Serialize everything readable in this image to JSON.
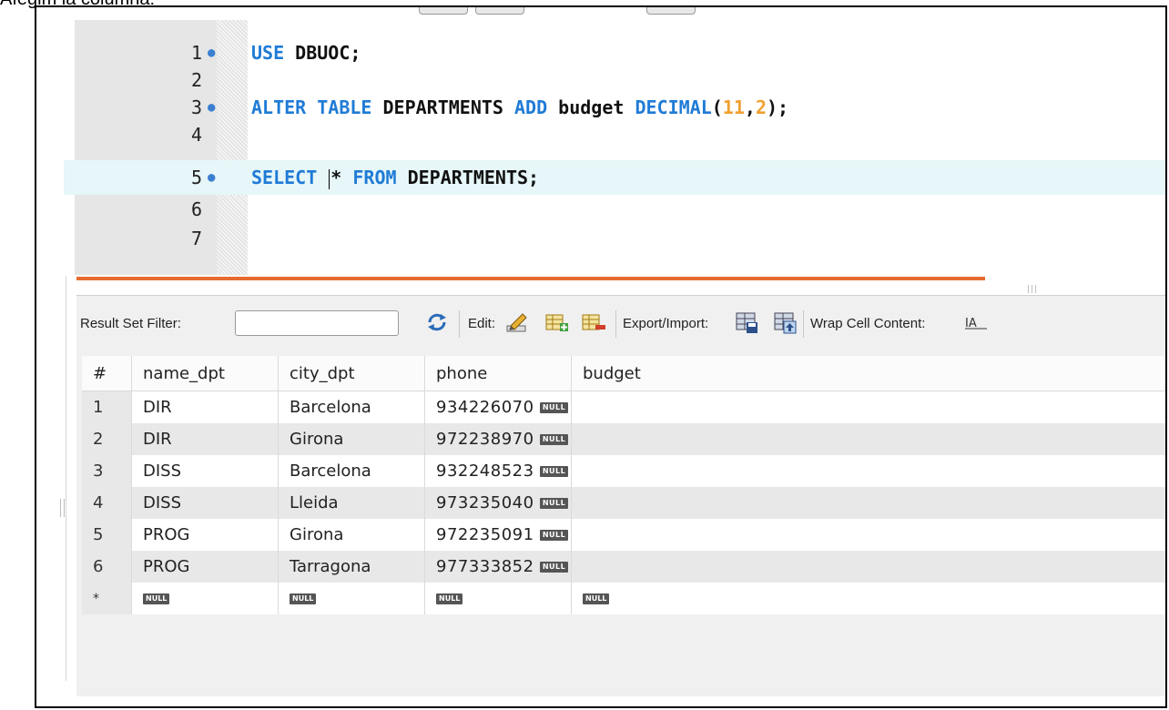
{
  "caption": "Afegim la columna:",
  "editor": {
    "lines": [
      {
        "n": "1",
        "marker": true
      },
      {
        "n": "2",
        "marker": false
      },
      {
        "n": "3",
        "marker": true
      },
      {
        "n": "4",
        "marker": false
      },
      {
        "n": "5",
        "marker": true
      },
      {
        "n": "6",
        "marker": false
      },
      {
        "n": "7",
        "marker": false
      }
    ],
    "code": {
      "l1_kw": "USE",
      "l1_rest": " DBUOC;",
      "l3_kw1": "ALTER TABLE",
      "l3_mid1": " DEPARTMENTS ",
      "l3_kw2": "ADD",
      "l3_mid2": " budget ",
      "l3_kw3": "DECIMAL",
      "l3_p1": "(",
      "l3_n1": "11",
      "l3_comma": ",",
      "l3_n2": "2",
      "l3_end": ");",
      "l5_kw1": "SELECT",
      "l5_star": "* ",
      "l5_kw2": "FROM",
      "l5_rest": " DEPARTMENTS;"
    }
  },
  "toolbar": {
    "filter_label": "Result Set Filter:",
    "edit_label": "Edit:",
    "export_label": "Export/Import:",
    "wrap_label": "Wrap Cell Content:"
  },
  "grid": {
    "columns": [
      "#",
      "name_dpt",
      "city_dpt",
      "phone",
      "budget"
    ],
    "null_label": "NULL",
    "new_row_marker": "*",
    "rows": [
      {
        "num": "1",
        "name_dpt": "DIR",
        "city_dpt": "Barcelona",
        "phone": "934226070"
      },
      {
        "num": "2",
        "name_dpt": "DIR",
        "city_dpt": "Girona",
        "phone": "972238970"
      },
      {
        "num": "3",
        "name_dpt": "DISS",
        "city_dpt": "Barcelona",
        "phone": "932248523"
      },
      {
        "num": "4",
        "name_dpt": "DISS",
        "city_dpt": "Lleida",
        "phone": "973235040"
      },
      {
        "num": "5",
        "name_dpt": "PROG",
        "city_dpt": "Girona",
        "phone": "972235091"
      },
      {
        "num": "6",
        "name_dpt": "PROG",
        "city_dpt": "Tarragona",
        "phone": "977333852"
      }
    ]
  },
  "colors": {
    "keyword": "#1f7bd6",
    "number": "#f0a030",
    "splitter": "#e86a2e",
    "current_line": "#e6f6f9"
  }
}
